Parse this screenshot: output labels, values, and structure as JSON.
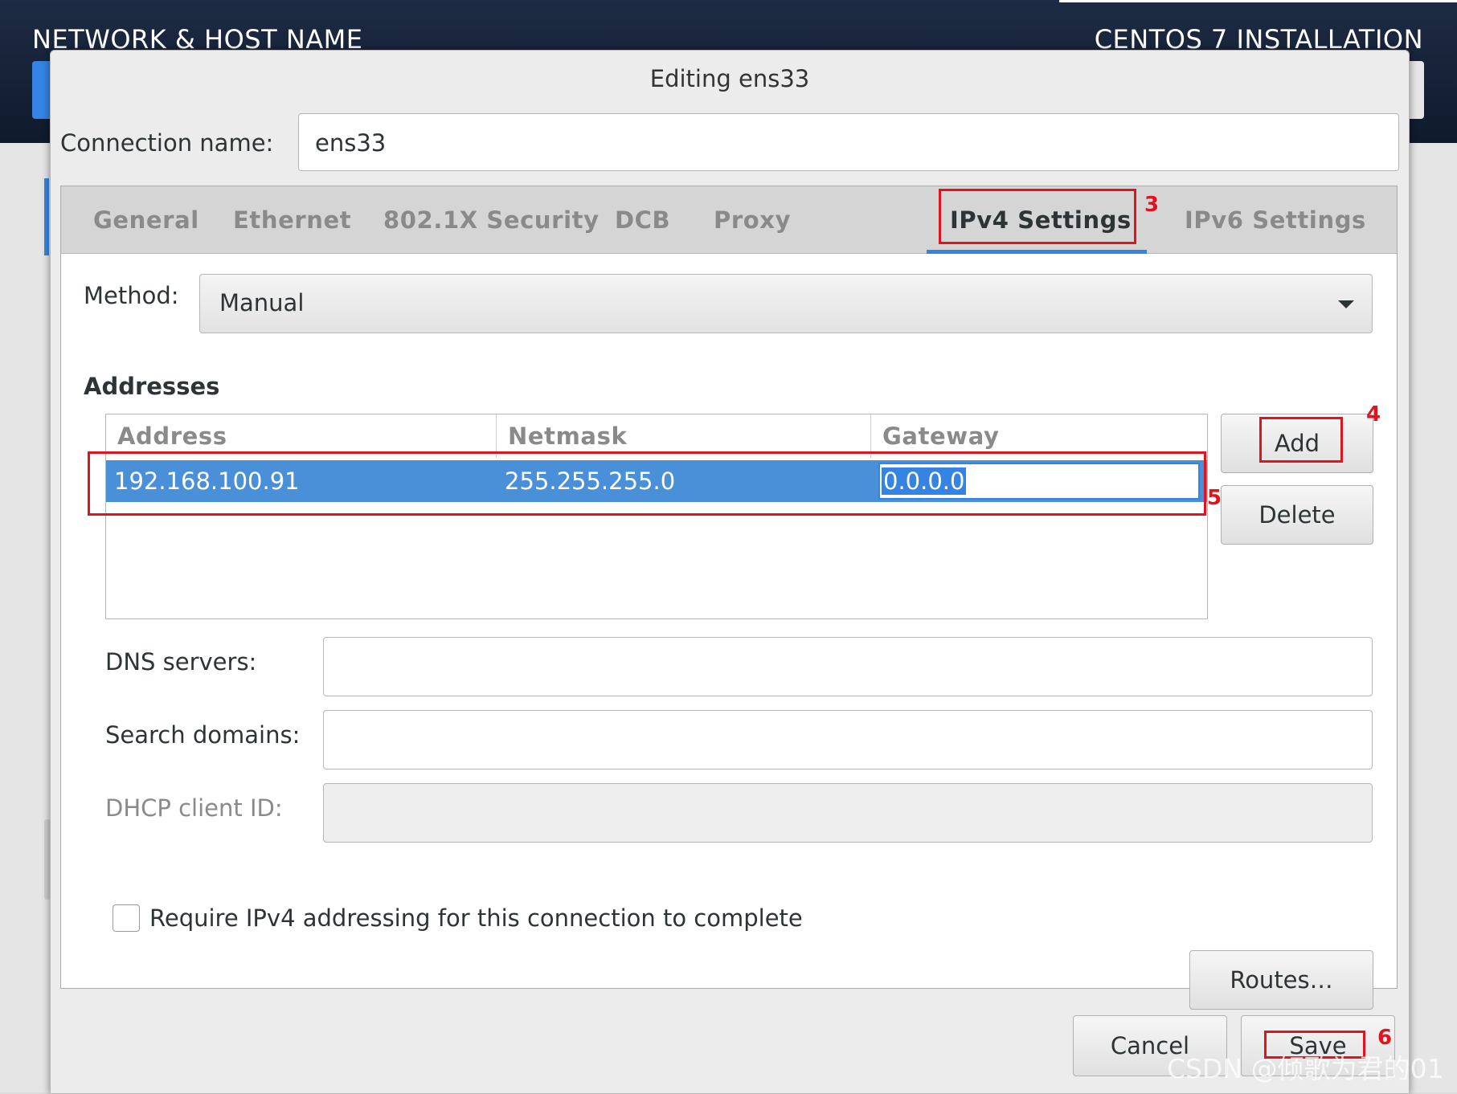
{
  "background": {
    "left_title": "NETWORK & HOST NAME",
    "right_title": "CENTOS 7 INSTALLATION"
  },
  "dialog": {
    "title": "Editing ens33",
    "connection_name_label": "Connection name:",
    "connection_name_value": "ens33",
    "tabs": [
      {
        "label": "General",
        "active": false
      },
      {
        "label": "Ethernet",
        "active": false
      },
      {
        "label": "802.1X Security",
        "active": false
      },
      {
        "label": "DCB",
        "active": false
      },
      {
        "label": "Proxy",
        "active": false
      },
      {
        "label": "IPv4 Settings",
        "active": true
      },
      {
        "label": "IPv6 Settings",
        "active": false
      }
    ],
    "ipv4": {
      "method_label": "Method:",
      "method_value": "Manual",
      "addresses_title": "Addresses",
      "columns": [
        "Address",
        "Netmask",
        "Gateway"
      ],
      "rows": [
        {
          "address": "192.168.100.91",
          "netmask": "255.255.255.0",
          "gateway": "0.0.0.0"
        }
      ],
      "add_button": "Add",
      "delete_button": "Delete",
      "dns_label": "DNS servers:",
      "dns_value": "",
      "search_label": "Search domains:",
      "search_value": "",
      "dhcp_label": "DHCP client ID:",
      "dhcp_value": "",
      "require_label": "Require IPv4 addressing for this connection to complete",
      "require_checked": false,
      "routes_button": "Routes…"
    },
    "cancel_button": "Cancel",
    "save_button": "Save"
  },
  "annotations": [
    "3",
    "4",
    "5",
    "6"
  ],
  "watermark": "CSDN @倾歌为君的01",
  "colors": {
    "accent": "#3584e4",
    "selection": "#4a90d9",
    "annotation": "#e0141e",
    "header_bg": "#1d2b44"
  }
}
